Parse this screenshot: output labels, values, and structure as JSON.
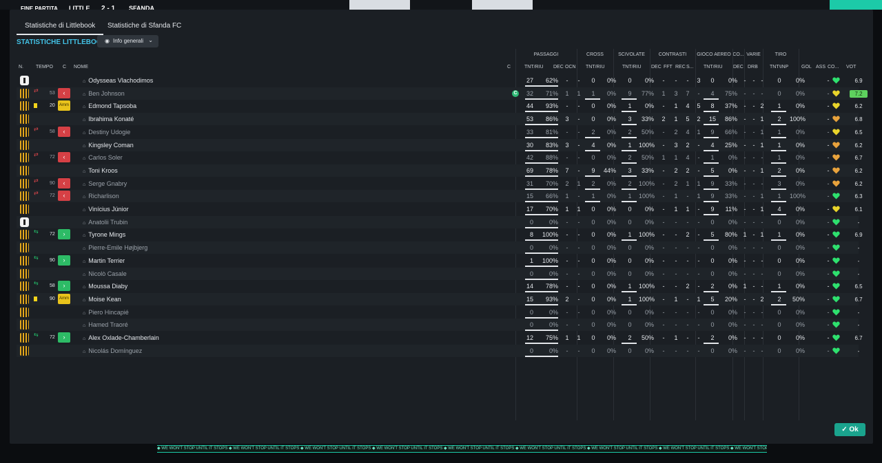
{
  "topbar": {
    "full_time": "FINE PARTITA",
    "home": "LITTLE",
    "score": "2 - 1",
    "away": "SFANDA"
  },
  "tabs": [
    "Statistiche di Littlebook",
    "Statistiche di Sfanda FC"
  ],
  "section_title": "STATISTICHE LITTLEBOOK",
  "view_select": "Info generali",
  "ok_button": "Ok",
  "ticker": "WE WON'T STOP UNTIL IT STOPS",
  "groups": [
    "PASSAGGI",
    "CROSS",
    "SCIVOLATE",
    "CONTRASTI",
    "GIOCO AEREO",
    "CO...",
    "VARIE",
    "TIRO"
  ],
  "columns": [
    "N.",
    "TEMPO",
    "C",
    "NOME",
    "C",
    "TNT/RIU",
    "DEC",
    "OCN",
    "TNT/RIU",
    "TNT/RIU",
    "DEC",
    "FFT",
    "REC",
    "S...",
    "TNT/RIU",
    "DEC",
    "DRB",
    "TNT\\INP",
    "GOL",
    "ASS",
    "CO...",
    "VOT"
  ],
  "players": [
    {
      "kit": "keeper",
      "sub": "",
      "min": "",
      "status": "",
      "name": "Odysseas Vlachodimos",
      "dim": false,
      "cap": false,
      "pass_t": "27",
      "pass_p": "62%",
      "pass_dec": "-",
      "pass_ocn": "-",
      "cross_t": "0",
      "cross_p": "0%",
      "sciv_t": "0",
      "sciv_p": "0%",
      "con_dec": "-",
      "con_fft": "-",
      "con_rec": "-",
      "con_s": "3",
      "air_t": "0",
      "air_p": "0%",
      "co": "-",
      "dec": "-",
      "drb": "-",
      "tiro_t": "0",
      "tiro_p": "0%",
      "gol": "",
      "ass": "",
      "c2": "-",
      "heart": "green",
      "vot": "6.9",
      "best": false
    },
    {
      "kit": "striped",
      "sub": "out",
      "min": "53",
      "status": "out",
      "name": "Ben Johnson",
      "dim": true,
      "cap": true,
      "pass_t": "32",
      "pass_p": "71%",
      "pass_dec": "1",
      "pass_ocn": "1",
      "cross_t": "1",
      "cross_p": "0%",
      "sciv_t": "9",
      "sciv_p": "77%",
      "con_dec": "1",
      "con_fft": "3",
      "con_rec": "7",
      "con_s": "-",
      "air_t": "4",
      "air_p": "75%",
      "co": "-",
      "dec": "-",
      "drb": "-",
      "tiro_t": "0",
      "tiro_p": "0%",
      "gol": "",
      "ass": "",
      "c2": "-",
      "heart": "yellow",
      "vot": "7.2",
      "best": true
    },
    {
      "kit": "striped",
      "sub": "yc",
      "min": "20",
      "status": "amm",
      "name": "Edmond Tapsoba",
      "dim": false,
      "cap": false,
      "pass_t": "44",
      "pass_p": "93%",
      "pass_dec": "-",
      "pass_ocn": "-",
      "cross_t": "0",
      "cross_p": "0%",
      "sciv_t": "1",
      "sciv_p": "0%",
      "con_dec": "-",
      "con_fft": "1",
      "con_rec": "4",
      "con_s": "5",
      "air_t": "8",
      "air_p": "37%",
      "co": "-",
      "dec": "-",
      "drb": "2",
      "tiro_t": "1",
      "tiro_p": "0%",
      "gol": "",
      "ass": "",
      "c2": "-",
      "heart": "yellow",
      "vot": "6.2",
      "best": false
    },
    {
      "kit": "striped",
      "sub": "",
      "min": "",
      "status": "",
      "name": "Ibrahima Konaté",
      "dim": false,
      "cap": false,
      "pass_t": "53",
      "pass_p": "86%",
      "pass_dec": "3",
      "pass_ocn": "-",
      "cross_t": "0",
      "cross_p": "0%",
      "sciv_t": "3",
      "sciv_p": "33%",
      "con_dec": "2",
      "con_fft": "1",
      "con_rec": "5",
      "con_s": "2",
      "air_t": "15",
      "air_p": "86%",
      "co": "-",
      "dec": "-",
      "drb": "1",
      "tiro_t": "2",
      "tiro_p": "100%",
      "gol": "",
      "ass": "",
      "c2": "-",
      "heart": "orange",
      "vot": "6.8",
      "best": false
    },
    {
      "kit": "striped",
      "sub": "out",
      "min": "58",
      "status": "out",
      "name": "Destiny Udogie",
      "dim": true,
      "cap": false,
      "pass_t": "33",
      "pass_p": "81%",
      "pass_dec": "-",
      "pass_ocn": "-",
      "cross_t": "2",
      "cross_p": "0%",
      "sciv_t": "2",
      "sciv_p": "50%",
      "con_dec": "-",
      "con_fft": "2",
      "con_rec": "4",
      "con_s": "1",
      "air_t": "9",
      "air_p": "66%",
      "co": "-",
      "dec": "-",
      "drb": "1",
      "tiro_t": "1",
      "tiro_p": "0%",
      "gol": "",
      "ass": "",
      "c2": "-",
      "heart": "yellow",
      "vot": "6.5",
      "best": false
    },
    {
      "kit": "striped",
      "sub": "",
      "min": "",
      "status": "",
      "name": "Kingsley Coman",
      "dim": false,
      "cap": false,
      "pass_t": "30",
      "pass_p": "83%",
      "pass_dec": "3",
      "pass_ocn": "-",
      "cross_t": "4",
      "cross_p": "0%",
      "sciv_t": "1",
      "sciv_p": "100%",
      "con_dec": "-",
      "con_fft": "3",
      "con_rec": "2",
      "con_s": "-",
      "air_t": "4",
      "air_p": "25%",
      "co": "-",
      "dec": "-",
      "drb": "1",
      "tiro_t": "1",
      "tiro_p": "0%",
      "gol": "",
      "ass": "",
      "c2": "-",
      "heart": "orange",
      "vot": "6.2",
      "best": false
    },
    {
      "kit": "striped",
      "sub": "out",
      "min": "72",
      "status": "out",
      "name": "Carlos Soler",
      "dim": true,
      "cap": false,
      "pass_t": "42",
      "pass_p": "88%",
      "pass_dec": "-",
      "pass_ocn": "-",
      "cross_t": "0",
      "cross_p": "0%",
      "sciv_t": "2",
      "sciv_p": "50%",
      "con_dec": "1",
      "con_fft": "1",
      "con_rec": "4",
      "con_s": "-",
      "air_t": "1",
      "air_p": "0%",
      "co": "-",
      "dec": "-",
      "drb": "-",
      "tiro_t": "1",
      "tiro_p": "0%",
      "gol": "",
      "ass": "",
      "c2": "-",
      "heart": "orange",
      "vot": "6.7",
      "best": false
    },
    {
      "kit": "striped",
      "sub": "",
      "min": "",
      "status": "",
      "name": "Toni Kroos",
      "dim": false,
      "cap": false,
      "pass_t": "69",
      "pass_p": "78%",
      "pass_dec": "7",
      "pass_ocn": "-",
      "cross_t": "9",
      "cross_p": "44%",
      "sciv_t": "3",
      "sciv_p": "33%",
      "con_dec": "-",
      "con_fft": "2",
      "con_rec": "2",
      "con_s": "-",
      "air_t": "5",
      "air_p": "0%",
      "co": "-",
      "dec": "-",
      "drb": "1",
      "tiro_t": "2",
      "tiro_p": "0%",
      "gol": "",
      "ass": "",
      "c2": "-",
      "heart": "orange",
      "vot": "6.2",
      "best": false
    },
    {
      "kit": "striped",
      "sub": "out",
      "min": "90",
      "status": "out",
      "name": "Serge Gnabry",
      "dim": true,
      "cap": false,
      "pass_t": "31",
      "pass_p": "70%",
      "pass_dec": "2",
      "pass_ocn": "1",
      "cross_t": "2",
      "cross_p": "0%",
      "sciv_t": "2",
      "sciv_p": "100%",
      "con_dec": "-",
      "con_fft": "2",
      "con_rec": "1",
      "con_s": "1",
      "air_t": "9",
      "air_p": "33%",
      "co": "-",
      "dec": "-",
      "drb": "-",
      "tiro_t": "3",
      "tiro_p": "0%",
      "gol": "",
      "ass": "",
      "c2": "-",
      "heart": "orange",
      "vot": "6.2",
      "best": false
    },
    {
      "kit": "striped",
      "sub": "out",
      "min": "72",
      "status": "out",
      "name": "Richarlison",
      "dim": true,
      "cap": false,
      "pass_t": "15",
      "pass_p": "66%",
      "pass_dec": "1",
      "pass_ocn": "-",
      "cross_t": "1",
      "cross_p": "0%",
      "sciv_t": "1",
      "sciv_p": "100%",
      "con_dec": "-",
      "con_fft": "1",
      "con_rec": "-",
      "con_s": "1",
      "air_t": "9",
      "air_p": "33%",
      "co": "-",
      "dec": "-",
      "drb": "1",
      "tiro_t": "1",
      "tiro_p": "100%",
      "gol": "",
      "ass": "",
      "c2": "-",
      "heart": "green",
      "vot": "6.3",
      "best": false
    },
    {
      "kit": "striped",
      "sub": "",
      "min": "",
      "status": "",
      "name": "Vinícius Júnior",
      "dim": false,
      "cap": false,
      "pass_t": "17",
      "pass_p": "70%",
      "pass_dec": "1",
      "pass_ocn": "1",
      "cross_t": "0",
      "cross_p": "0%",
      "sciv_t": "0",
      "sciv_p": "0%",
      "con_dec": "-",
      "con_fft": "1",
      "con_rec": "1",
      "con_s": "-",
      "air_t": "9",
      "air_p": "11%",
      "co": "-",
      "dec": "-",
      "drb": "1",
      "tiro_t": "4",
      "tiro_p": "0%",
      "gol": "",
      "ass": "",
      "c2": "-",
      "heart": "yellow",
      "vot": "6.1",
      "best": false
    },
    {
      "kit": "keeper",
      "sub": "",
      "min": "",
      "status": "",
      "name": "Anatolii Trubin",
      "dim": true,
      "cap": false,
      "pass_t": "0",
      "pass_p": "0%",
      "pass_dec": "-",
      "pass_ocn": "-",
      "cross_t": "0",
      "cross_p": "0%",
      "sciv_t": "0",
      "sciv_p": "0%",
      "con_dec": "-",
      "con_fft": "-",
      "con_rec": "-",
      "con_s": "-",
      "air_t": "0",
      "air_p": "0%",
      "co": "-",
      "dec": "-",
      "drb": "-",
      "tiro_t": "0",
      "tiro_p": "0%",
      "gol": "",
      "ass": "",
      "c2": "-",
      "heart": "green",
      "vot": "-",
      "best": false
    },
    {
      "kit": "striped",
      "sub": "in",
      "min": "72",
      "status": "in",
      "name": "Tyrone Mings",
      "dim": false,
      "cap": false,
      "pass_t": "8",
      "pass_p": "100%",
      "pass_dec": "-",
      "pass_ocn": "-",
      "cross_t": "0",
      "cross_p": "0%",
      "sciv_t": "1",
      "sciv_p": "100%",
      "con_dec": "-",
      "con_fft": "-",
      "con_rec": "2",
      "con_s": "-",
      "air_t": "5",
      "air_p": "80%",
      "co": "1",
      "dec": "-",
      "drb": "1",
      "tiro_t": "1",
      "tiro_p": "0%",
      "gol": "",
      "ass": "",
      "c2": "-",
      "heart": "green",
      "vot": "6.9",
      "best": false
    },
    {
      "kit": "striped",
      "sub": "",
      "min": "",
      "status": "",
      "name": "Pierre-Emile Højbjerg",
      "dim": true,
      "cap": false,
      "pass_t": "0",
      "pass_p": "0%",
      "pass_dec": "-",
      "pass_ocn": "-",
      "cross_t": "0",
      "cross_p": "0%",
      "sciv_t": "0",
      "sciv_p": "0%",
      "con_dec": "-",
      "con_fft": "-",
      "con_rec": "-",
      "con_s": "-",
      "air_t": "0",
      "air_p": "0%",
      "co": "-",
      "dec": "-",
      "drb": "-",
      "tiro_t": "0",
      "tiro_p": "0%",
      "gol": "",
      "ass": "",
      "c2": "-",
      "heart": "green",
      "vot": "-",
      "best": false
    },
    {
      "kit": "striped",
      "sub": "in",
      "min": "90",
      "status": "in",
      "name": "Martin Terrier",
      "dim": false,
      "cap": false,
      "pass_t": "1",
      "pass_p": "100%",
      "pass_dec": "-",
      "pass_ocn": "-",
      "cross_t": "0",
      "cross_p": "0%",
      "sciv_t": "0",
      "sciv_p": "0%",
      "con_dec": "-",
      "con_fft": "-",
      "con_rec": "-",
      "con_s": "-",
      "air_t": "0",
      "air_p": "0%",
      "co": "-",
      "dec": "-",
      "drb": "-",
      "tiro_t": "0",
      "tiro_p": "0%",
      "gol": "",
      "ass": "",
      "c2": "-",
      "heart": "green",
      "vot": "-",
      "best": false
    },
    {
      "kit": "striped",
      "sub": "",
      "min": "",
      "status": "",
      "name": "Nicolò Casale",
      "dim": true,
      "cap": false,
      "pass_t": "0",
      "pass_p": "0%",
      "pass_dec": "-",
      "pass_ocn": "-",
      "cross_t": "0",
      "cross_p": "0%",
      "sciv_t": "0",
      "sciv_p": "0%",
      "con_dec": "-",
      "con_fft": "-",
      "con_rec": "-",
      "con_s": "-",
      "air_t": "0",
      "air_p": "0%",
      "co": "-",
      "dec": "-",
      "drb": "-",
      "tiro_t": "0",
      "tiro_p": "0%",
      "gol": "",
      "ass": "",
      "c2": "-",
      "heart": "green",
      "vot": "-",
      "best": false
    },
    {
      "kit": "striped",
      "sub": "in",
      "min": "58",
      "status": "in",
      "name": "Moussa Diaby",
      "dim": false,
      "cap": false,
      "pass_t": "14",
      "pass_p": "78%",
      "pass_dec": "-",
      "pass_ocn": "-",
      "cross_t": "0",
      "cross_p": "0%",
      "sciv_t": "1",
      "sciv_p": "100%",
      "con_dec": "-",
      "con_fft": "-",
      "con_rec": "2",
      "con_s": "-",
      "air_t": "2",
      "air_p": "0%",
      "co": "1",
      "dec": "-",
      "drb": "-",
      "tiro_t": "1",
      "tiro_p": "0%",
      "gol": "",
      "ass": "",
      "c2": "-",
      "heart": "green",
      "vot": "6.5",
      "best": false
    },
    {
      "kit": "striped",
      "sub": "yc",
      "min": "90",
      "status": "amm",
      "name": "Moise Kean",
      "dim": false,
      "cap": false,
      "pass_t": "15",
      "pass_p": "93%",
      "pass_dec": "2",
      "pass_ocn": "-",
      "cross_t": "0",
      "cross_p": "0%",
      "sciv_t": "1",
      "sciv_p": "100%",
      "con_dec": "-",
      "con_fft": "1",
      "con_rec": "-",
      "con_s": "1",
      "air_t": "5",
      "air_p": "20%",
      "co": "-",
      "dec": "-",
      "drb": "2",
      "tiro_t": "2",
      "tiro_p": "50%",
      "gol": "",
      "ass": "",
      "c2": "-",
      "heart": "green",
      "vot": "6.7",
      "best": false
    },
    {
      "kit": "striped",
      "sub": "",
      "min": "",
      "status": "",
      "name": "Piero Hincapié",
      "dim": true,
      "cap": false,
      "pass_t": "0",
      "pass_p": "0%",
      "pass_dec": "-",
      "pass_ocn": "-",
      "cross_t": "0",
      "cross_p": "0%",
      "sciv_t": "0",
      "sciv_p": "0%",
      "con_dec": "-",
      "con_fft": "-",
      "con_rec": "-",
      "con_s": "-",
      "air_t": "0",
      "air_p": "0%",
      "co": "-",
      "dec": "-",
      "drb": "-",
      "tiro_t": "0",
      "tiro_p": "0%",
      "gol": "",
      "ass": "",
      "c2": "-",
      "heart": "green",
      "vot": "-",
      "best": false
    },
    {
      "kit": "striped",
      "sub": "",
      "min": "",
      "status": "",
      "name": "Hamed Traoré",
      "dim": true,
      "cap": false,
      "pass_t": "0",
      "pass_p": "0%",
      "pass_dec": "-",
      "pass_ocn": "-",
      "cross_t": "0",
      "cross_p": "0%",
      "sciv_t": "0",
      "sciv_p": "0%",
      "con_dec": "-",
      "con_fft": "-",
      "con_rec": "-",
      "con_s": "-",
      "air_t": "0",
      "air_p": "0%",
      "co": "-",
      "dec": "-",
      "drb": "-",
      "tiro_t": "0",
      "tiro_p": "0%",
      "gol": "",
      "ass": "",
      "c2": "-",
      "heart": "green",
      "vot": "-",
      "best": false
    },
    {
      "kit": "striped",
      "sub": "in",
      "min": "72",
      "status": "in",
      "name": "Alex Oxlade-Chamberlain",
      "dim": false,
      "cap": false,
      "pass_t": "12",
      "pass_p": "75%",
      "pass_dec": "1",
      "pass_ocn": "1",
      "cross_t": "0",
      "cross_p": "0%",
      "sciv_t": "2",
      "sciv_p": "50%",
      "con_dec": "-",
      "con_fft": "1",
      "con_rec": "-",
      "con_s": "-",
      "air_t": "2",
      "air_p": "0%",
      "co": "-",
      "dec": "-",
      "drb": "-",
      "tiro_t": "0",
      "tiro_p": "0%",
      "gol": "",
      "ass": "",
      "c2": "-",
      "heart": "green",
      "vot": "6.7",
      "best": false
    },
    {
      "kit": "striped",
      "sub": "",
      "min": "",
      "status": "",
      "name": "Nicolás Domínguez",
      "dim": true,
      "cap": false,
      "pass_t": "0",
      "pass_p": "0%",
      "pass_dec": "-",
      "pass_ocn": "-",
      "cross_t": "0",
      "cross_p": "0%",
      "sciv_t": "0",
      "sciv_p": "0%",
      "con_dec": "-",
      "con_fft": "-",
      "con_rec": "-",
      "con_s": "-",
      "air_t": "0",
      "air_p": "0%",
      "co": "-",
      "dec": "-",
      "drb": "-",
      "tiro_t": "0",
      "tiro_p": "0%",
      "gol": "",
      "ass": "",
      "c2": "-",
      "heart": "green",
      "vot": "-",
      "best": false
    }
  ],
  "labels": {
    "amm": "Amm",
    "captain": "C"
  },
  "colors": {
    "accent": "#43c2e6",
    "ok": "#1aa38d",
    "out": "#d64045",
    "in": "#2dbb66",
    "yellow_card": "#f2d31b",
    "best_rating": "#5ed15e",
    "heart_green": "#2ee06e",
    "heart_yellow": "#e9d42b",
    "heart_orange": "#e8a23c"
  }
}
